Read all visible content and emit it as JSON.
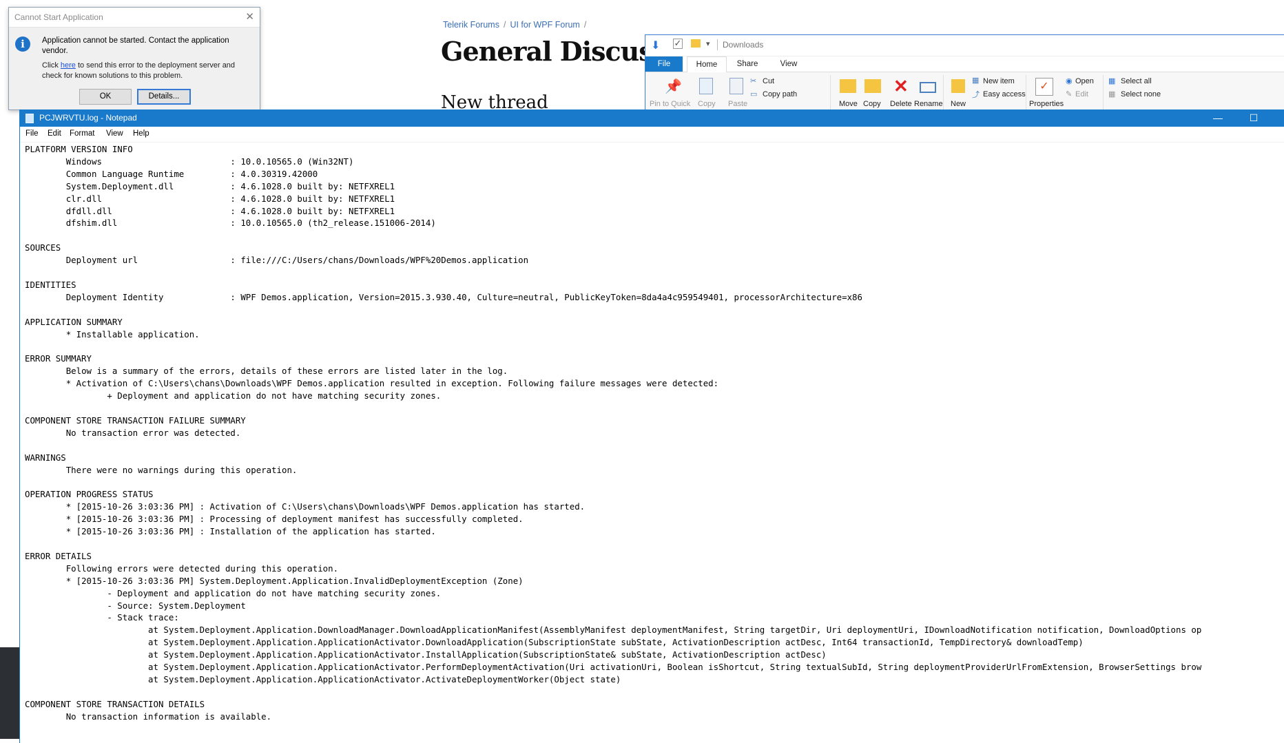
{
  "forum": {
    "breadcrumb": [
      "Telerik Forums",
      "UI for WPF Forum"
    ],
    "breadcrumb_sep": "/",
    "title": "General Discussi",
    "new_thread": "New thread"
  },
  "dialog": {
    "title": "Cannot Start Application",
    "message": "Application cannot be started. Contact the application vendor.",
    "detail_prefix": "Click ",
    "detail_link": "here",
    "detail_suffix": " to send this error to the deployment server and check for known solutions to this problem.",
    "ok_label": "OK",
    "details_label": "Details..."
  },
  "explorer": {
    "path": "Downloads",
    "tabs": [
      "File",
      "Home",
      "Share",
      "View"
    ],
    "ribbon": {
      "pin": "Pin to Quick",
      "copy": "Copy",
      "paste": "Paste",
      "cut": "Cut",
      "copy_path": "Copy path",
      "move": "Move",
      "copy_to": "Copy",
      "delete": "Delete",
      "rename": "Rename",
      "new": "New",
      "new_item": "New item",
      "easy_access": "Easy access",
      "properties": "Properties",
      "open": "Open",
      "edit": "Edit",
      "select_all": "Select all",
      "select_none": "Select none"
    }
  },
  "notepad": {
    "title": "PCJWRVTU.log - Notepad",
    "menu": [
      "File",
      "Edit",
      "Format",
      "View",
      "Help"
    ],
    "lines": [
      "PLATFORM VERSION INFO",
      "\tWindows \t\t\t: 10.0.10565.0 (Win32NT)",
      "\tCommon Language Runtime \t: 4.0.30319.42000",
      "\tSystem.Deployment.dll \t\t: 4.6.1028.0 built by: NETFXREL1",
      "\tclr.dll \t\t\t: 4.6.1028.0 built by: NETFXREL1",
      "\tdfdll.dll \t\t\t: 4.6.1028.0 built by: NETFXREL1",
      "\tdfshim.dll \t\t\t: 10.0.10565.0 (th2_release.151006-2014)",
      "",
      "SOURCES",
      "\tDeployment url\t\t\t: file:///C:/Users/chans/Downloads/WPF%20Demos.application",
      "",
      "IDENTITIES",
      "\tDeployment Identity\t\t: WPF Demos.application, Version=2015.3.930.40, Culture=neutral, PublicKeyToken=8da4a4c959549401, processorArchitecture=x86",
      "",
      "APPLICATION SUMMARY",
      "\t* Installable application.",
      "",
      "ERROR SUMMARY",
      "\tBelow is a summary of the errors, details of these errors are listed later in the log.",
      "\t* Activation of C:\\Users\\chans\\Downloads\\WPF Demos.application resulted in exception. Following failure messages were detected:",
      "\t\t+ Deployment and application do not have matching security zones.",
      "",
      "COMPONENT STORE TRANSACTION FAILURE SUMMARY",
      "\tNo transaction error was detected.",
      "",
      "WARNINGS",
      "\tThere were no warnings during this operation.",
      "",
      "OPERATION PROGRESS STATUS",
      "\t* [2015-10-26 3:03:36 PM] : Activation of C:\\Users\\chans\\Downloads\\WPF Demos.application has started.",
      "\t* [2015-10-26 3:03:36 PM] : Processing of deployment manifest has successfully completed.",
      "\t* [2015-10-26 3:03:36 PM] : Installation of the application has started.",
      "",
      "ERROR DETAILS",
      "\tFollowing errors were detected during this operation.",
      "\t* [2015-10-26 3:03:36 PM] System.Deployment.Application.InvalidDeploymentException (Zone)",
      "\t\t- Deployment and application do not have matching security zones.",
      "\t\t- Source: System.Deployment",
      "\t\t- Stack trace:",
      "\t\t\tat System.Deployment.Application.DownloadManager.DownloadApplicationManifest(AssemblyManifest deploymentManifest, String targetDir, Uri deploymentUri, IDownloadNotification notification, DownloadOptions op",
      "\t\t\tat System.Deployment.Application.ApplicationActivator.DownloadApplication(SubscriptionState subState, ActivationDescription actDesc, Int64 transactionId, TempDirectory& downloadTemp)",
      "\t\t\tat System.Deployment.Application.ApplicationActivator.InstallApplication(SubscriptionState& subState, ActivationDescription actDesc)",
      "\t\t\tat System.Deployment.Application.ApplicationActivator.PerformDeploymentActivation(Uri activationUri, Boolean isShortcut, String textualSubId, String deploymentProviderUrlFromExtension, BrowserSettings brow",
      "\t\t\tat System.Deployment.Application.ApplicationActivator.ActivateDeploymentWorker(Object state)",
      "",
      "COMPONENT STORE TRANSACTION DETAILS",
      "\tNo transaction information is available."
    ]
  }
}
